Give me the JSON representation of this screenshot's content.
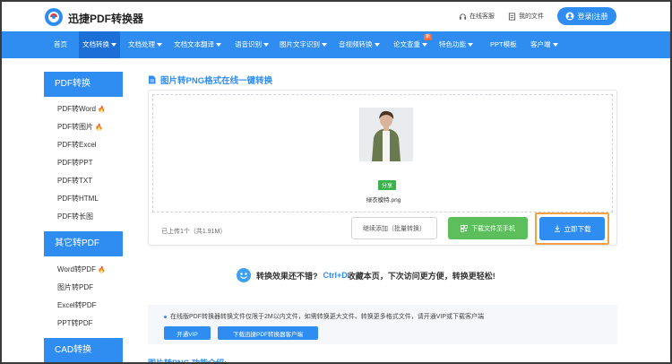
{
  "header": {
    "brand": "迅捷PDF转换器",
    "online_service": "在线客服",
    "my_files": "我的文件",
    "login": "登录|注册"
  },
  "nav": {
    "items": [
      {
        "label": "首页",
        "dropdown": false
      },
      {
        "label": "文档转换",
        "dropdown": true
      },
      {
        "label": "文档处理",
        "dropdown": true
      },
      {
        "label": "文档文本翻译",
        "dropdown": true
      },
      {
        "label": "语音识别",
        "dropdown": true
      },
      {
        "label": "图片文字识别",
        "dropdown": true
      },
      {
        "label": "音视频转换",
        "dropdown": true
      },
      {
        "label": "论文查重",
        "dropdown": true
      },
      {
        "label": "特色功能",
        "dropdown": true
      },
      {
        "label": "PPT模板",
        "dropdown": false
      },
      {
        "label": "客户端",
        "dropdown": true
      }
    ],
    "new_badge": "新"
  },
  "sidebar": {
    "sections": [
      {
        "title": "PDF转换",
        "items": [
          {
            "label": "PDF转Word",
            "hot": true
          },
          {
            "label": "PDF转图片",
            "hot": true
          },
          {
            "label": "PDF转Excel",
            "hot": false
          },
          {
            "label": "PDF转PPT",
            "hot": false
          },
          {
            "label": "PDF转TXT",
            "hot": false
          },
          {
            "label": "PDF转HTML",
            "hot": false
          },
          {
            "label": "PDF转长图",
            "hot": false
          }
        ]
      },
      {
        "title": "其它转PDF",
        "items": [
          {
            "label": "Word转PDF",
            "hot": true
          },
          {
            "label": "图片转PDF",
            "hot": false
          },
          {
            "label": "Excel转PDF",
            "hot": false
          },
          {
            "label": "PPT转PDF",
            "hot": false
          }
        ]
      },
      {
        "title": "CAD转换",
        "items": []
      }
    ]
  },
  "main": {
    "title": "图片转PNG格式在线一键转换",
    "file": {
      "tag": "分享",
      "name": "绿衣模特.png"
    },
    "upload_info": "已上传1个（共1.91M）",
    "continue_button": "继续添加（批量转换）",
    "to_phone_button": "下载文件至手机",
    "download_button": "立即下载",
    "tip": {
      "before": "转换效果还不错?",
      "shortcut": "Ctrl+D",
      "after": "收藏本页，下次访问更方便，转换更轻松!"
    },
    "notice": "在线版PDF转换器转换文件仅限于2M以内文件，如需转换更大文件、转换更多格式文件，请开通VIP或下载客户端",
    "vip_button": "开通VIP",
    "client_button": "下载迅捷PDF转换器客户端",
    "intro_title": "图片转PNG 功能介绍:"
  },
  "colors": {
    "primary": "#2f8cf0",
    "green": "#5cbf5c",
    "highlight": "#f5a142",
    "hot": "#ff6a2a"
  }
}
